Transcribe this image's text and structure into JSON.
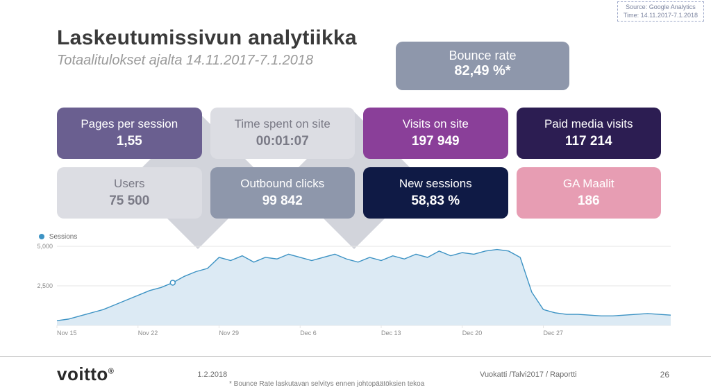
{
  "source_box": {
    "line1": "Source: Google Analytics",
    "line2": "Time: 14.11.2017-7.1.2018"
  },
  "header": {
    "title": "Laskeutumissivun analytiikka",
    "subtitle": "Totaalitulokset ajalta 14.11.2017-7.1.2018"
  },
  "bounce": {
    "label": "Bounce rate",
    "value": "82,49 %*"
  },
  "metrics": {
    "pps": {
      "label": "Pages per session",
      "value": "1,55"
    },
    "time": {
      "label": "Time spent on site",
      "value": "00:01:07"
    },
    "visits": {
      "label": "Visits on site",
      "value": "197 949"
    },
    "paid": {
      "label": "Paid media visits",
      "value": "117 214"
    },
    "users": {
      "label": "Users",
      "value": "75 500"
    },
    "outbound": {
      "label": "Outbound clicks",
      "value": "99 842"
    },
    "newsess": {
      "label": "New sessions",
      "value": "58,83 %"
    },
    "gamaalit": {
      "label": "GA Maalit",
      "value": "186"
    }
  },
  "chart_legend": "Sessions",
  "chart_data": {
    "type": "area",
    "title": "",
    "xlabel": "",
    "ylabel": "",
    "ylim": [
      0,
      5000
    ],
    "yticks": [
      2500,
      5000
    ],
    "x_tick_labels": [
      "Nov 15",
      "Nov 22",
      "Nov 29",
      "Dec 6",
      "Dec 13",
      "Dec 20",
      "Dec 27"
    ],
    "x_tick_indices": [
      0,
      7,
      14,
      21,
      28,
      35,
      42
    ],
    "series": [
      {
        "name": "Sessions",
        "color": "#3d93c4",
        "values": [
          300,
          400,
          600,
          800,
          1000,
          1300,
          1600,
          1900,
          2200,
          2400,
          2700,
          3100,
          3400,
          3600,
          4300,
          4100,
          4400,
          4000,
          4300,
          4200,
          4500,
          4300,
          4100,
          4300,
          4500,
          4200,
          4000,
          4300,
          4100,
          4400,
          4200,
          4500,
          4300,
          4700,
          4400,
          4600,
          4500,
          4700,
          4800,
          4700,
          4300,
          2100,
          1000,
          800,
          700,
          700,
          650,
          600,
          600,
          650,
          700,
          750,
          700,
          650
        ]
      }
    ],
    "marker_index": 10
  },
  "footer": {
    "logo": "voitto",
    "date": "1.2.2018",
    "path": "Vuokatti /Talvi2017 / Raportti",
    "page": "26",
    "footnote": "* Bounce Rate laskutavan selvitys ennen johtopäätöksien tekoa"
  }
}
